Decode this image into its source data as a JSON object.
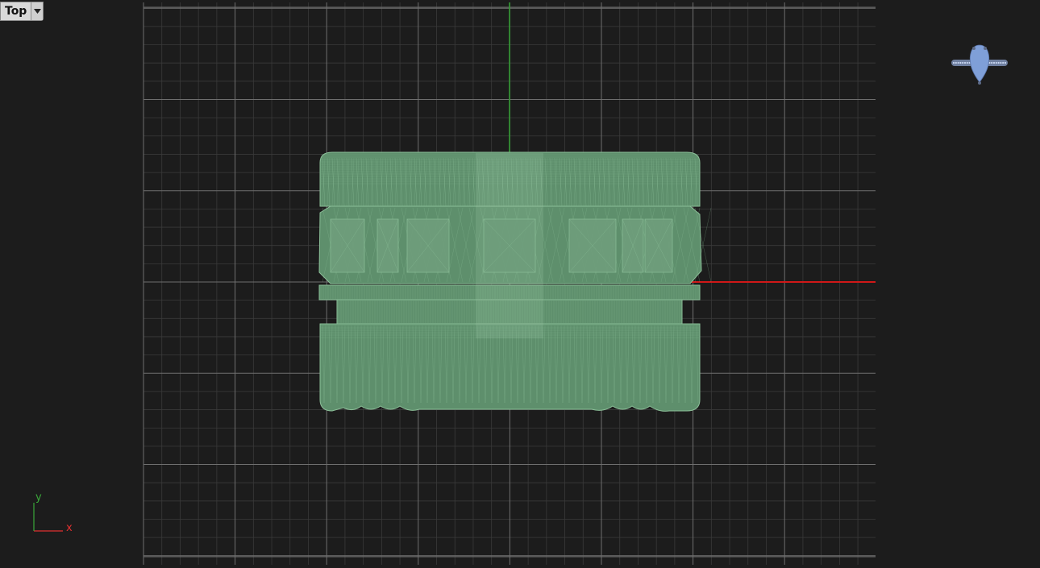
{
  "viewport": {
    "view_name": "Top",
    "background_color": "#1c1c1c",
    "grid_minor_color": "#3a3a3a",
    "grid_major_color": "#6e6e6e",
    "x_axis_color": "#d01818",
    "y_axis_color": "#2e9c2e",
    "mesh_fill_color": "#5e8f6c",
    "mesh_wire_color": "#8bbf98"
  },
  "axis_icon": {
    "x_label": "x",
    "y_label": "y",
    "x_color": "#e03030",
    "y_color": "#3aa83a"
  },
  "preview": {
    "icon": "ring-with-pear-gem-icon",
    "gem_color": "#7f9fd8",
    "band_color": "#6f7f9f"
  }
}
